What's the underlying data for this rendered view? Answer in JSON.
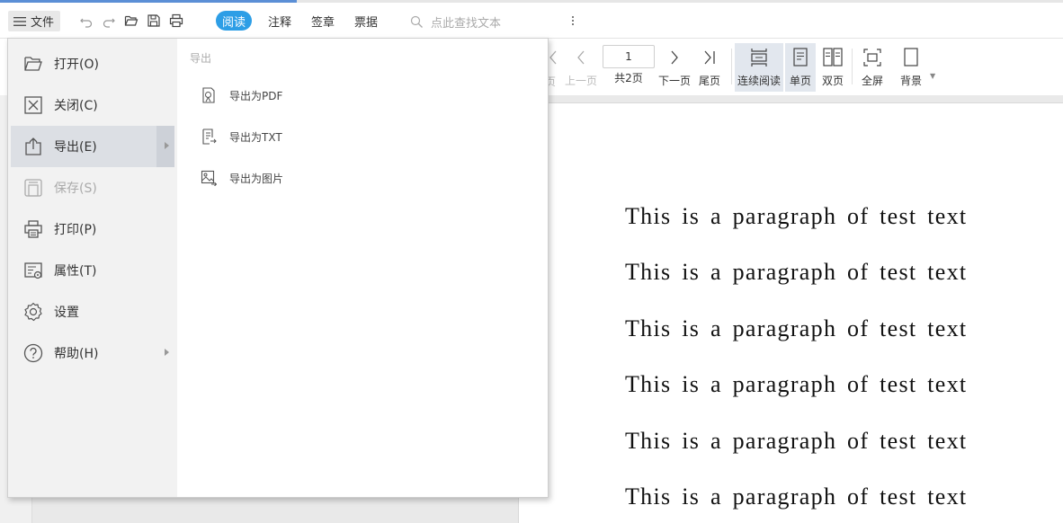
{
  "topbar": {
    "file_label": "文件",
    "icons": [
      "undo-icon",
      "redo-icon",
      "folder-open-icon",
      "save-icon",
      "print-icon"
    ],
    "mode_tabs": [
      {
        "label": "阅读",
        "active": true
      },
      {
        "label": "注释",
        "active": false
      },
      {
        "label": "签章",
        "active": false
      },
      {
        "label": "票据",
        "active": false
      }
    ],
    "search_placeholder": "点此查找文本"
  },
  "toolbar": {
    "first_page_label": "页",
    "prev_label": "上一页",
    "page_input_value": "1",
    "page_total_label": "共2页",
    "next_label": "下一页",
    "last_label": "尾页",
    "continuous_label": "连续阅读",
    "single_label": "单页",
    "double_label": "双页",
    "fullscreen_label": "全屏",
    "background_label": "背景"
  },
  "file_menu": {
    "items": [
      {
        "label": "打开(O)",
        "icon": "folder-open-icon",
        "state": "normal"
      },
      {
        "label": "关闭(C)",
        "icon": "close-box-icon",
        "state": "normal"
      },
      {
        "label": "导出(E)",
        "icon": "export-icon",
        "state": "active",
        "has_submenu": true
      },
      {
        "label": "保存(S)",
        "icon": "save-icon",
        "state": "disabled"
      },
      {
        "label": "打印(P)",
        "icon": "print-icon",
        "state": "normal"
      },
      {
        "label": "属性(T)",
        "icon": "properties-icon",
        "state": "normal"
      },
      {
        "label": "设置",
        "icon": "gear-icon",
        "state": "normal"
      },
      {
        "label": "帮助(H)",
        "icon": "help-icon",
        "state": "normal",
        "has_submenu": true
      }
    ],
    "submenu": {
      "title": "导出",
      "items": [
        {
          "label": "导出为PDF",
          "icon": "export-pdf-icon"
        },
        {
          "label": "导出为TXT",
          "icon": "export-txt-icon"
        },
        {
          "label": "导出为图片",
          "icon": "export-image-icon"
        }
      ]
    }
  },
  "document": {
    "lines": [
      "This is a paragraph of test text",
      "This is a paragraph of test text",
      "This is a paragraph of test text",
      "This is a paragraph of test text",
      "This is a paragraph of test text",
      "This is a paragraph of test text"
    ]
  },
  "colors": {
    "accent": "#2d9ee6",
    "top_strip": "#5b8fd6",
    "menu_active": "#dcdfe4"
  }
}
